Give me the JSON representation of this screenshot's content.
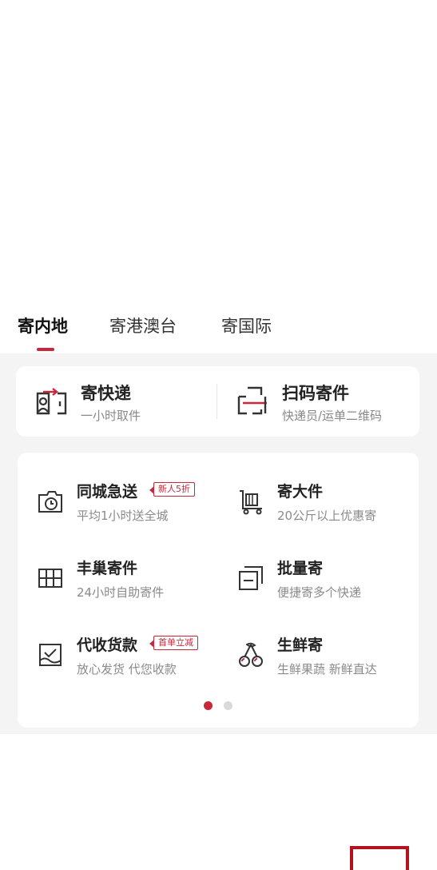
{
  "tabs": [
    {
      "label": "寄内地",
      "active": true
    },
    {
      "label": "寄港澳台",
      "active": false
    },
    {
      "label": "寄国际",
      "active": false
    }
  ],
  "primary_actions": [
    {
      "title": "寄快递",
      "subtitle": "一小时取件",
      "icon": "parcel-locker-icon"
    },
    {
      "title": "扫码寄件",
      "subtitle": "快递员/运单二维码",
      "icon": "scan-code-icon"
    }
  ],
  "services": [
    {
      "title": "同城急送",
      "subtitle": "平均1小时送全城",
      "badge": "新人5折",
      "icon": "clock-box-icon"
    },
    {
      "title": "寄大件",
      "subtitle": "20公斤以上优惠寄",
      "badge": "",
      "icon": "cart-icon"
    },
    {
      "title": "丰巢寄件",
      "subtitle": "24小时自助寄件",
      "badge": "",
      "icon": "locker-grid-icon"
    },
    {
      "title": "批量寄",
      "subtitle": "便捷寄多个快递",
      "badge": "",
      "icon": "stack-icon"
    },
    {
      "title": "代收货款",
      "subtitle": "放心发货 代您收款",
      "badge": "首单立减",
      "icon": "payment-icon"
    },
    {
      "title": "生鲜寄",
      "subtitle": "生鲜果蔬 新鲜直达",
      "badge": "",
      "icon": "cherry-icon"
    }
  ],
  "pagination": {
    "current": 1,
    "total": 2
  },
  "colors": {
    "accent": "#c8283a",
    "page_bg": "#f4f4f4",
    "dot_inactive": "#d9d9d9"
  }
}
